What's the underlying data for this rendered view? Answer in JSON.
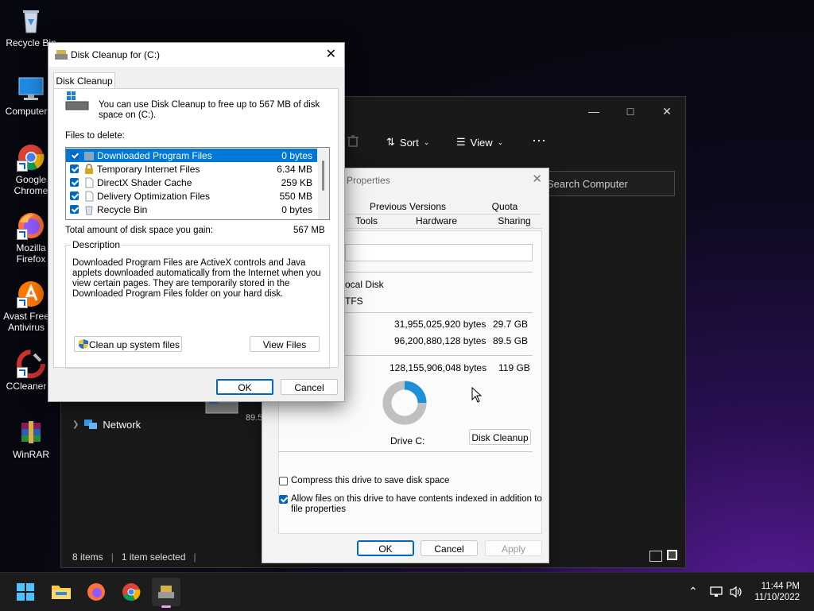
{
  "desktop": {
    "icons": [
      {
        "label": "Recycle Bin"
      },
      {
        "label": "Computer"
      },
      {
        "label": "Google Chrome"
      },
      {
        "label": "Mozilla Firefox"
      },
      {
        "label": "Avast Free Antivirus"
      },
      {
        "label": "CCleaner"
      },
      {
        "label": "WinRAR"
      }
    ]
  },
  "explorer": {
    "toolbar": {
      "sort_label": "Sort",
      "view_label": "View",
      "more_label": "···"
    },
    "search_placeholder": "Search Computer",
    "nav_network": "Network",
    "drive_free_label": "89.5",
    "status": {
      "items": "8 items",
      "selected": "1 item selected"
    }
  },
  "properties": {
    "title": "Properties",
    "tabs": {
      "previous_versions": "Previous Versions",
      "quota": "Quota",
      "tools": "Tools",
      "hardware": "Hardware",
      "sharing": "Sharing"
    },
    "type_value": "ocal Disk",
    "fs_value": "TFS",
    "used_bytes": "31,955,025,920 bytes",
    "used_gb": "29.7 GB",
    "free_bytes": "96,200,880,128 bytes",
    "free_gb": "89.5 GB",
    "capacity_bytes": "128,155,906,048 bytes",
    "capacity_gb": "119 GB",
    "drive_label": "Drive C:",
    "disk_cleanup_button": "Disk Cleanup",
    "compress_label": "Compress this drive to save disk space",
    "index_label_1": "Allow files on this drive to have contents indexed in addition to",
    "index_label_2": "file properties",
    "ok": "OK",
    "cancel": "Cancel",
    "apply": "Apply",
    "used_fraction": 0.25,
    "colors": {
      "used": "#1e90d8",
      "free": "#c0c0c0"
    }
  },
  "cleanup": {
    "title": "Disk Cleanup for  (C:)",
    "tab": "Disk Cleanup",
    "intro_1": "You can use Disk Cleanup to free up to 567 MB of disk",
    "intro_2": "space on  (C:).",
    "files_label": "Files to delete:",
    "files": [
      {
        "name": "Downloaded Program Files",
        "size": "0 bytes",
        "icon": "folder-icon"
      },
      {
        "name": "Temporary Internet Files",
        "size": "6.34 MB",
        "icon": "lock-icon"
      },
      {
        "name": "DirectX Shader Cache",
        "size": "259 KB",
        "icon": "file-icon"
      },
      {
        "name": "Delivery Optimization Files",
        "size": "550 MB",
        "icon": "file-icon"
      },
      {
        "name": "Recycle Bin",
        "size": "0 bytes",
        "icon": "recycle-bin-icon"
      }
    ],
    "total_label": "Total amount of disk space you gain:",
    "total_value": "567 MB",
    "description_legend": "Description",
    "description_text": "Downloaded Program Files are ActiveX controls and Java applets downloaded automatically from the Internet when you view certain pages. They are temporarily stored in the Downloaded Program Files folder on your hard disk.",
    "cleanup_system_button": "Clean up system files",
    "view_files_button": "View Files",
    "ok": "OK",
    "cancel": "Cancel"
  },
  "taskbar": {
    "time": "11:44 PM",
    "date": "11/10/2022"
  }
}
